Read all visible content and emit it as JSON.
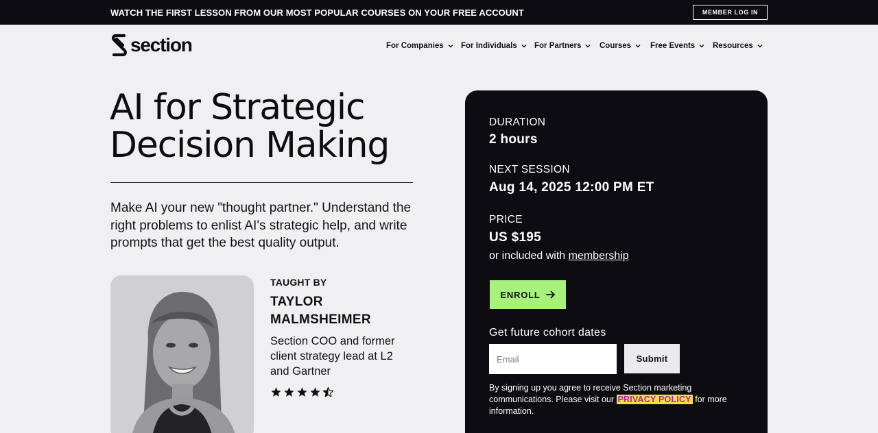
{
  "topbar": {
    "promo_text": "WATCH THE FIRST LESSON FROM OUR MOST POPULAR COURSES ON YOUR FREE ACCOUNT",
    "member_login": "MEMBER LOG IN"
  },
  "logo": {
    "text": "section"
  },
  "nav": {
    "items": [
      {
        "label": "For Companies"
      },
      {
        "label": "For Individuals"
      },
      {
        "label": "For Partners"
      },
      {
        "label": "Courses"
      },
      {
        "label": "Free Events"
      },
      {
        "label": "Resources"
      }
    ]
  },
  "hero": {
    "title_line1": "AI for Strategic",
    "title_line2": "Decision Making",
    "description": "Make AI your new \"thought partner.\" Understand the right problems to enlist AI's strategic help, and write prompts that get the best quality output."
  },
  "instructor": {
    "heading": "TAUGHT BY",
    "name_line1": "TAYLOR",
    "name_line2": "MALMSHEIMER",
    "bio": "Section COO and former client strategy lead at L2 and Gartner",
    "rating": 4.5
  },
  "course_card": {
    "duration_label": "DURATION",
    "duration_value": "2 hours",
    "next_session_label": "NEXT SESSION",
    "next_session_value": "Aug 14, 2025 12:00 PM ET",
    "price_label": "PRICE",
    "price_value": "US $195",
    "included_prefix": "or included with ",
    "included_link": "membership",
    "enroll_label": "ENROLL",
    "cohort_heading": "Get future cohort dates",
    "email_placeholder": "Email",
    "submit_label": "Submit",
    "legal_text_1": "By signing up you agree to receive Section marketing communications. Please visit our ",
    "privacy_link": "PRIVACY POLICY",
    "legal_text_2": " for more information."
  },
  "colors": {
    "topbar_bg": "#0d0c10",
    "page_bg": "#f0f0f3",
    "card_bg": "#0d0c10",
    "enroll_bg": "#a6f27a",
    "privacy_highlight": "#ece245",
    "privacy_text": "#b71fa4"
  }
}
